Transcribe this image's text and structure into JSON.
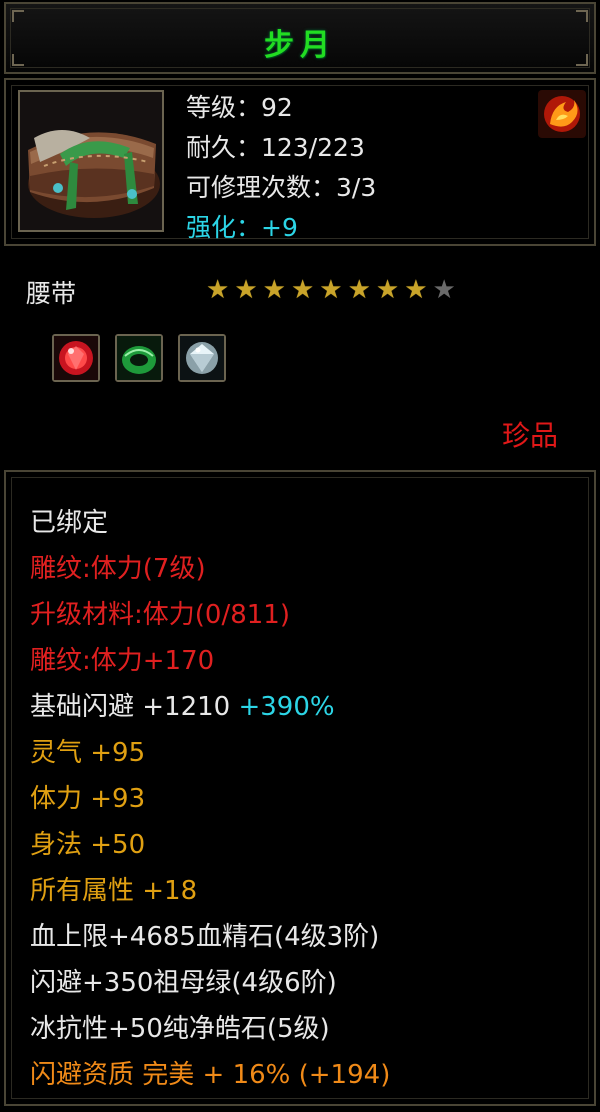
{
  "title": "步月",
  "header": {
    "level": "等级：92",
    "durability": "耐久：123/223",
    "repair_count": "可修理次数：3/3",
    "enhancement": "强化：+9",
    "item_icon": "belt-icon",
    "set_icon": "phoenix-emblem-icon"
  },
  "item_type": "腰带",
  "stars": {
    "filled": 8,
    "total": 9
  },
  "gems": [
    {
      "name": "ruby-gem-icon",
      "color": "#d01a24"
    },
    {
      "name": "jade-ring-icon",
      "color": "#1e9a3a"
    },
    {
      "name": "diamond-gem-icon",
      "color": "#c8d8e0"
    }
  ],
  "rarity": "珍品",
  "attributes": {
    "bound": "已绑定",
    "engrave_level": "雕纹:体力(7级)",
    "upgrade_material": "升级材料:体力(0/811)",
    "engrave_bonus": "雕纹:体力+170",
    "base_dodge": {
      "label": "基础闪避 +1210",
      "bonus": "+390%"
    },
    "spirit": "灵气 +95",
    "stamina": "体力 +93",
    "agility": "身法 +50",
    "all_stats": "所有属性 +18",
    "gem_hp": "血上限+4685血精石(4级3阶)",
    "gem_dodge": "闪避+350祖母绿(4级6阶)",
    "gem_ice": "冰抗性+50纯净皓石(5级)",
    "dodge_quality": "闪避资质 完美 + 16% (+194)"
  },
  "colors": {
    "title_green": "#22dd22",
    "enhance_cyan": "#2cd5e6",
    "red": "#e02020",
    "gold": "#e0a012",
    "orange": "#f08a18",
    "frame": "#4a4535"
  }
}
